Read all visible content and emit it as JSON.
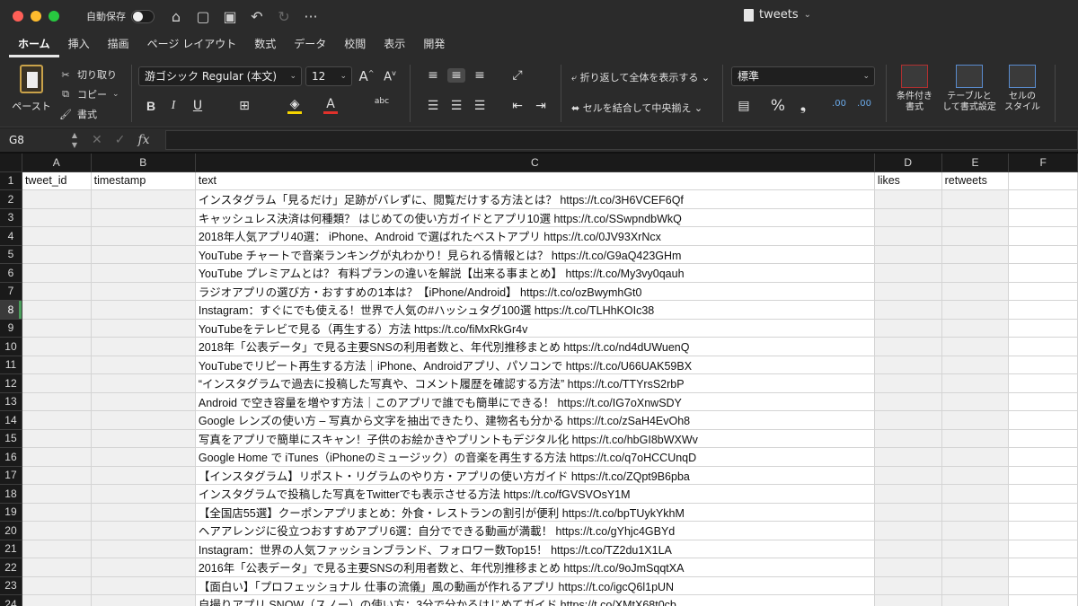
{
  "titlebar": {
    "autosave_label": "自動保存",
    "doc_title": "tweets",
    "doc_chevron": "⌄",
    "icons": [
      "home-icon",
      "folder-icon",
      "save-icon",
      "undo-icon",
      "redo-icon",
      "more-icon"
    ],
    "icon_glyphs": [
      "⌂",
      "▢",
      "▣",
      "↶",
      "↻",
      "···"
    ]
  },
  "tabs": [
    "ホーム",
    "挿入",
    "描画",
    "ページ レイアウト",
    "数式",
    "データ",
    "校閲",
    "表示",
    "開発"
  ],
  "ribbon": {
    "paste_label": "ペースト",
    "cut_label": "切り取り",
    "copy_label": "コピー",
    "format_painter_label": "書式",
    "font_name": "游ゴシック Regular (本文)",
    "font_size": "12",
    "wrap_text_label": "折り返して全体を表示する",
    "merge_center_label": "セルを結合して中央揃え",
    "number_format": "標準",
    "cond_format_label_1": "条件付き",
    "cond_format_label_2": "書式",
    "table_format_label_1": "テーブルと",
    "table_format_label_2": "して書式設定",
    "cell_style_label_1": "セルの",
    "cell_style_label_2": "スタイル",
    "bold": "B",
    "italic": "I",
    "underline": "U",
    "grow_font": "A",
    "shrink_font": "A",
    "percent": "%",
    "comma": "❟",
    "inc_decimal": ".00",
    "dec_decimal": ".00",
    "phonetic": "abc",
    "font_color_letter": "A",
    "accent_yellow": "#f5d400",
    "accent_red": "#e0312b"
  },
  "formula_bar": {
    "cell_ref": "G8",
    "fx": "fx",
    "value": ""
  },
  "sheet": {
    "columns": [
      "A",
      "B",
      "C",
      "D",
      "E",
      "F"
    ],
    "selected_row": 8,
    "rows": [
      {
        "n": "1",
        "a": "tweet_id",
        "b": "timestamp",
        "c": "text",
        "d": "likes",
        "e": "retweets"
      },
      {
        "n": "2",
        "a": "",
        "b": "",
        "c": "インスタグラム「見るだけ」足跡がバレずに、閲覧だけする方法とは？ https://t.co/3H6VCEF6Qf",
        "d": "",
        "e": ""
      },
      {
        "n": "3",
        "a": "",
        "b": "",
        "c": "キャッシュレス決済は何種類？ はじめての使い方ガイドとアプリ10選 https://t.co/SSwpndbWkQ",
        "d": "",
        "e": ""
      },
      {
        "n": "4",
        "a": "",
        "b": "",
        "c": "2018年人気アプリ40選： iPhone、Android で選ばれたベストアプリ https://t.co/0JV93XrNcx",
        "d": "",
        "e": ""
      },
      {
        "n": "5",
        "a": "",
        "b": "",
        "c": "YouTube チャートで音楽ランキングが丸わかり！見られる情報とは？ https://t.co/G9aQ423GHm",
        "d": "",
        "e": ""
      },
      {
        "n": "6",
        "a": "",
        "b": "",
        "c": "YouTube プレミアムとは？ 有料プランの違いを解説【出来る事まとめ】 https://t.co/My3vy0qauh",
        "d": "",
        "e": ""
      },
      {
        "n": "7",
        "a": "",
        "b": "",
        "c": "ラジオアプリの選び方・おすすめの1本は？【iPhone/Android】 https://t.co/ozBwymhGt0",
        "d": "",
        "e": ""
      },
      {
        "n": "8",
        "a": "",
        "b": "",
        "c": "Instagram：すぐにでも使える！世界で人気の#ハッシュタグ100選 https://t.co/TLHhKOIc38",
        "d": "",
        "e": ""
      },
      {
        "n": "9",
        "a": "",
        "b": "",
        "c": "YouTubeをテレビで見る（再生する）方法 https://t.co/fiMxRkGr4v",
        "d": "",
        "e": ""
      },
      {
        "n": "10",
        "a": "",
        "b": "",
        "c": "2018年「公表データ」で見る主要SNSの利用者数と、年代別推移まとめ https://t.co/nd4dUWuenQ",
        "d": "",
        "e": ""
      },
      {
        "n": "11",
        "a": "",
        "b": "",
        "c": "YouTubeでリピート再生する方法｜iPhone、Androidアプリ、パソコンで https://t.co/U66UAK59BX",
        "d": "",
        "e": ""
      },
      {
        "n": "12",
        "a": "",
        "b": "",
        "c": "“インスタグラムで過去に投稿した写真や、コメント履歴を確認する方法” https://t.co/TTYrsS2rbP",
        "d": "",
        "e": ""
      },
      {
        "n": "13",
        "a": "",
        "b": "",
        "c": "Android で空き容量を増やす方法｜このアプリで誰でも簡単にできる！ https://t.co/IG7oXnwSDY",
        "d": "",
        "e": ""
      },
      {
        "n": "14",
        "a": "",
        "b": "",
        "c": "Google レンズの使い方 – 写真から文字を抽出できたり、建物名も分かる https://t.co/zSaH4EvOh8",
        "d": "",
        "e": ""
      },
      {
        "n": "15",
        "a": "",
        "b": "",
        "c": "写真をアプリで簡単にスキャン！子供のお絵かきやプリントもデジタル化 https://t.co/hbGI8bWXWv",
        "d": "",
        "e": ""
      },
      {
        "n": "16",
        "a": "",
        "b": "",
        "c": "Google Home で iTunes（iPhoneのミュージック）の音楽を再生する方法 https://t.co/q7oHCCUnqD",
        "d": "",
        "e": ""
      },
      {
        "n": "17",
        "a": "",
        "b": "",
        "c": "【インスタグラム】リポスト・リグラムのやり方・アプリの使い方ガイド https://t.co/ZQpt9B6pba",
        "d": "",
        "e": ""
      },
      {
        "n": "18",
        "a": "",
        "b": "",
        "c": "インスタグラムで投稿した写真をTwitterでも表示させる方法 https://t.co/fGVSVOsY1M",
        "d": "",
        "e": ""
      },
      {
        "n": "19",
        "a": "",
        "b": "",
        "c": "【全国店55選】クーポンアプリまとめ：外食・レストランの割引が便利 https://t.co/bpTUykYkhM",
        "d": "",
        "e": ""
      },
      {
        "n": "20",
        "a": "",
        "b": "",
        "c": "ヘアアレンジに役立つおすすめアプリ6選：自分でできる動画が満載！ https://t.co/gYhjc4GBYd",
        "d": "",
        "e": ""
      },
      {
        "n": "21",
        "a": "",
        "b": "",
        "c": "Instagram：世界の人気ファッションブランド、フォロワー数Top15！ https://t.co/TZ2du1X1LA",
        "d": "",
        "e": ""
      },
      {
        "n": "22",
        "a": "",
        "b": "",
        "c": "2016年「公表データ」で見る主要SNSの利用者数と、年代別推移まとめ https://t.co/9oJmSqqtXA",
        "d": "",
        "e": ""
      },
      {
        "n": "23",
        "a": "",
        "b": "",
        "c": "【面白い】「プロフェッショナル 仕事の流儀」風の動画が作れるアプリ https://t.co/igcQ6l1pUN",
        "d": "",
        "e": ""
      },
      {
        "n": "24",
        "a": "",
        "b": "",
        "c": "自撮りアプリ SNOW（スノー）の使い方：3分で分かるはじめてガイド https://t.co/XMtX68t0cb",
        "d": "",
        "e": ""
      }
    ]
  }
}
